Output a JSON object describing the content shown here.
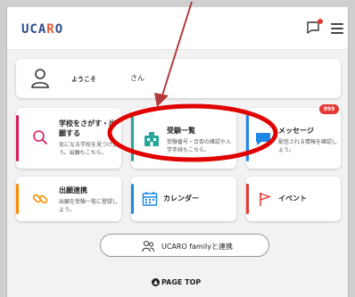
{
  "header": {
    "logo": "UCARO",
    "logo_accent_color": "#e25b3a",
    "logo_color": "#2f4a8c",
    "notification_icon": "message-icon",
    "menu_icon": "hamburger-icon"
  },
  "welcome": {
    "greeting": "ようこそ",
    "suffix": "さん",
    "icon": "user-icon"
  },
  "tiles": [
    {
      "title": "学校をさがす・出願する",
      "desc": "気になる学校を見つけよう。出願もこちら。",
      "icon": "search-icon",
      "accent": "#d81b60"
    },
    {
      "title": "受験一覧",
      "desc": "受験番号・合否の確認や入学手続もこちら。",
      "icon": "school-icon",
      "accent": "#26a69a"
    },
    {
      "title": "メッセージ",
      "desc": "配信される情報を確認しよう。",
      "icon": "message-icon",
      "accent": "#1e88e5",
      "badge": "999"
    },
    {
      "title": "出願連携",
      "desc": "出願を受験一覧に登録しよう。",
      "icon": "link-icon",
      "accent": "#fb8c00"
    },
    {
      "title": "カレンダー",
      "desc": "",
      "icon": "calendar-icon",
      "accent": "#1e88e5"
    },
    {
      "title": "イベント",
      "desc": "",
      "icon": "flag-icon",
      "accent": "#e53935"
    }
  ],
  "family_button": {
    "label": "UCARO familyと連携",
    "icon": "family-icon"
  },
  "page_top": {
    "label": "PAGE TOP",
    "icon": "arrow-up-icon"
  },
  "annotation": {
    "color": "#e00000",
    "arrow_color": "#b23a3a"
  }
}
